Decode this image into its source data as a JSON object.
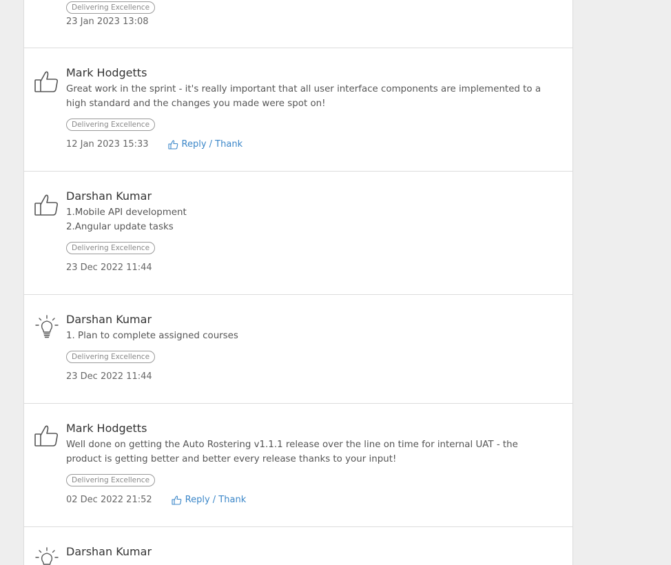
{
  "feed": {
    "partial_top": {
      "tag": "Delivering Excellence",
      "date": "23 Jan 2023 13:08"
    },
    "items": [
      {
        "icon": "thumbs-up-icon",
        "author": "Mark Hodgetts",
        "message": "Great work in the sprint - it's really important that all user interface components are implemented to a high standard and the changes you made were spot on!",
        "tag": "Delivering Excellence",
        "date": "12 Jan 2023 15:33",
        "reply_label": "Reply / Thank"
      },
      {
        "icon": "thumbs-up-icon",
        "author": "Darshan Kumar",
        "message": "1.Mobile API development\n2.Angular update tasks",
        "tag": "Delivering Excellence",
        "date": "23 Dec 2022 11:44"
      },
      {
        "icon": "lightbulb-icon",
        "author": "Darshan Kumar",
        "message": "1. Plan to complete assigned courses",
        "tag": "Delivering Excellence",
        "date": "23 Dec 2022 11:44"
      },
      {
        "icon": "thumbs-up-icon",
        "author": "Mark Hodgetts",
        "message": "Well done on getting the Auto Rostering v1.1.1 release over the line on time for internal UAT - the product is getting better and better every release thanks to your input!",
        "tag": "Delivering Excellence",
        "date": "02 Dec 2022 21:52",
        "reply_label": "Reply / Thank"
      },
      {
        "icon": "lightbulb-icon",
        "author": "Darshan Kumar"
      }
    ]
  },
  "colors": {
    "link": "#3a86c8",
    "background": "#eeeeee",
    "card": "#ffffff",
    "divider": "#dcdcdc"
  }
}
